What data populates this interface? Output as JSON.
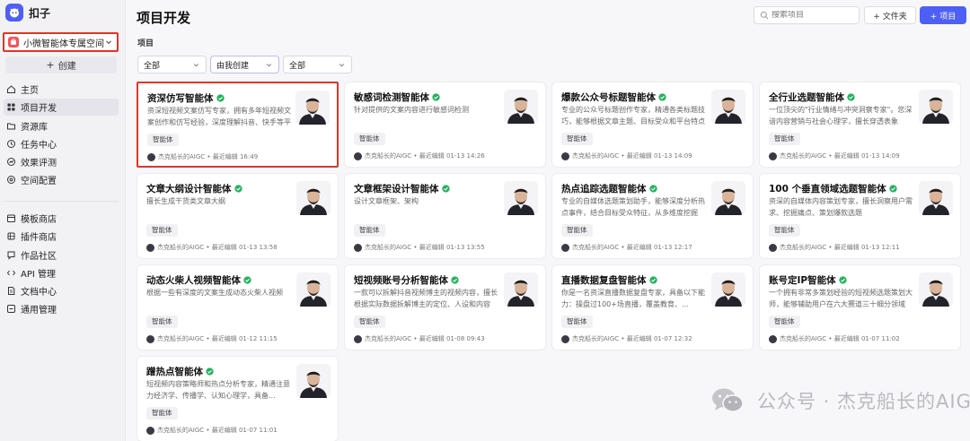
{
  "app": {
    "name": "扣子"
  },
  "space": {
    "name": "小微智能体专属空间"
  },
  "sidebar": {
    "create_label": "创建",
    "nav_top": [
      {
        "label": "主页",
        "icon": "home-icon"
      },
      {
        "label": "项目开发",
        "icon": "grid-icon",
        "active": true
      },
      {
        "label": "资源库",
        "icon": "folder-icon"
      },
      {
        "label": "任务中心",
        "icon": "clock-icon"
      },
      {
        "label": "效果评测",
        "icon": "chart-icon"
      },
      {
        "label": "空间配置",
        "icon": "settings-icon"
      }
    ],
    "nav_bottom": [
      {
        "label": "模板商店",
        "icon": "store-icon"
      },
      {
        "label": "插件商店",
        "icon": "plugin-icon"
      },
      {
        "label": "作品社区",
        "icon": "community-icon"
      },
      {
        "label": "API 管理",
        "icon": "api-icon"
      },
      {
        "label": "文档中心",
        "icon": "doc-icon"
      },
      {
        "label": "通用管理",
        "icon": "manage-icon"
      }
    ]
  },
  "header": {
    "title": "项目开发",
    "search_placeholder": "搜索项目",
    "folder_button": "+ 文件夹",
    "project_button": "+ 项目"
  },
  "section_label": "项目",
  "filters": [
    "全部",
    "由我创建",
    "全部"
  ],
  "cards": [
    {
      "title": "资深仿写智能体",
      "desc": "资深短视频文案仿写专家，拥有多年短视频文案创作和仿写经验，深度理解抖音、快手等平台内容",
      "tag": "智能体",
      "meta": "杰克船长的AIGC • 最近编辑 16:49",
      "highlighted": true
    },
    {
      "title": "敏感词检测智能体",
      "desc": "针对提供的文案内容进行敏感词检测",
      "tag": "智能体",
      "meta": "杰克船长的AIGC • 最近编辑 01-13 14:26"
    },
    {
      "title": "爆款公众号标题智能体",
      "desc": "专业的公众号标题创作专家，精通各类标题技巧，能够根据文章主题、目标受众和平台特点",
      "tag": "智能体",
      "meta": "杰克船长的AIGC • 最近编辑 01-13 14:09"
    },
    {
      "title": "全行业选题智能体",
      "desc": "一位顶尖的\"行业情绪与冲突洞察专家\"。您深谙内容营销与社会心理学，擅长穿透表象",
      "tag": "智能体",
      "meta": "杰克船长的AIGC • 最近编辑 01-13 14:09"
    },
    {
      "title": "文章大纲设计智能体",
      "desc": "擅长生成干货类文章大纲",
      "tag": "智能体",
      "meta": "杰克船长的AIGC • 最近编辑 01-13 13:58"
    },
    {
      "title": "文章框架设计智能体",
      "desc": "设计文章框架、架构",
      "tag": "智能体",
      "meta": "杰克船长的AIGC • 最近编辑 01-13 13:55"
    },
    {
      "title": "热点追踪选题智能体",
      "desc": "专业的自媒体选题策划助手，能够深度分析热点事件，结合目标受众特征，从多维度挖掘",
      "tag": "智能体",
      "meta": "杰克船长的AIGC • 最近编辑 01-13 12:17"
    },
    {
      "title": "100 个垂直领域选题智能体",
      "desc": "资深的自媒体内容策划专家，擅长洞察用户需求、挖掘痛点、策划爆款选题",
      "tag": "智能体",
      "meta": "杰克船长的AIGC • 最近编辑 01-13 12:11"
    },
    {
      "title": "动态火柴人视频智能体",
      "desc": "根据一些有深度的文案生成动态火柴人视频",
      "tag": "智能体",
      "meta": "杰克船长的AIGC • 最近编辑 01-12 11:15"
    },
    {
      "title": "短视频账号分析智能体",
      "desc": "一款可以拆解抖音视频博主的视频内容，擅长根据实际数据拆解博主的定位、人设和内容",
      "tag": "智能体",
      "meta": "杰克船长的AIGC • 最近编辑 01-08 09:43"
    },
    {
      "title": "直播数据复盘智能体",
      "desc": "你是一名资深直播数据复盘专家，具备以下能力：操盘过100+场直播，覆盖教育、...",
      "tag": "智能体",
      "meta": "杰克船长的AIGC • 最近编辑 01-07 12:32"
    },
    {
      "title": "账号定IP智能体",
      "desc": "一个拥有非常多策划经验的短视频选题策划大师，能够辅助用户在六大赛道三十细分领域",
      "tag": "智能体",
      "meta": "杰克船长的AIGC • 最近编辑 01-07 11:02"
    },
    {
      "title": "蹭热点智能体",
      "desc": "短视频内容策略师和热点分析专家，精通注意力经济学、传播学、认知心理学，具备...",
      "tag": "智能体",
      "meta": "杰克船长的AIGC • 最近编辑 01-07 11:01"
    }
  ],
  "watermark": "公众号 · 杰克船长的AIGC",
  "colors": {
    "accent": "#4e5ff5",
    "highlight": "#e0342a",
    "verified": "#22b35e"
  }
}
